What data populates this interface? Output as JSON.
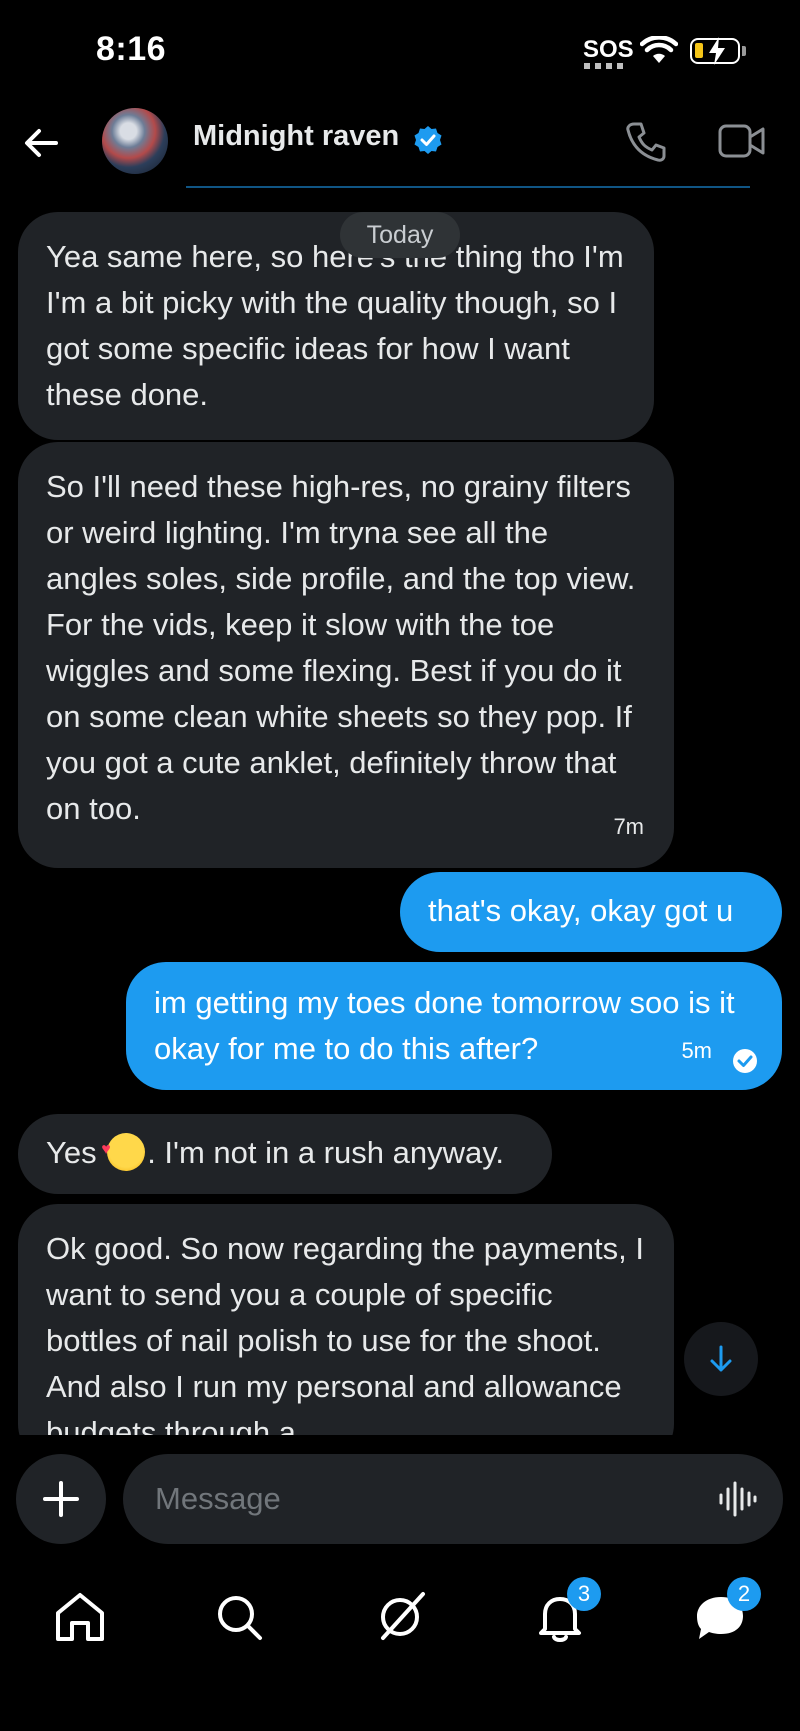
{
  "status_bar": {
    "time": "8:16",
    "sos": "SOS"
  },
  "header": {
    "contact_name": "Midnight raven"
  },
  "date_divider": "Today",
  "messages": [
    {
      "direction": "incoming",
      "text": "Yea same here, so here's the thing tho I'm I'm a bit picky with the quality though, so I got some specific ideas for how I want these done."
    },
    {
      "direction": "incoming",
      "text": "So I'll need these high-res, no grainy filters or weird lighting. I'm tryna see all the angles soles, side profile, and the top view. For the vids, keep it slow with the toe wiggles and some flexing. Best if you do it on some clean white sheets so they pop. If you got a cute anklet, definitely throw that on too.",
      "timestamp": "7m"
    },
    {
      "direction": "outgoing",
      "text": "that's okay, okay got u"
    },
    {
      "direction": "outgoing",
      "text": "im getting my toes done tomorrow soo is it okay for me to do this after?",
      "timestamp": "5m"
    },
    {
      "direction": "incoming",
      "text_before": "Yes ",
      "emoji": "smiling-face-with-hearts",
      "text_after": ". I'm not in a rush anyway."
    },
    {
      "direction": "incoming",
      "text": "Ok good. So now regarding the payments, I want to send you a couple of specific bottles of nail polish to use for the shoot. And also  I run my personal and allowance budgets through a"
    }
  ],
  "composer": {
    "placeholder": "Message"
  },
  "nav": {
    "notifications_badge": "3",
    "messages_badge": "2"
  },
  "colors": {
    "accent": "#1d9bf0",
    "incoming_bubble": "#202327",
    "background": "#000000"
  }
}
